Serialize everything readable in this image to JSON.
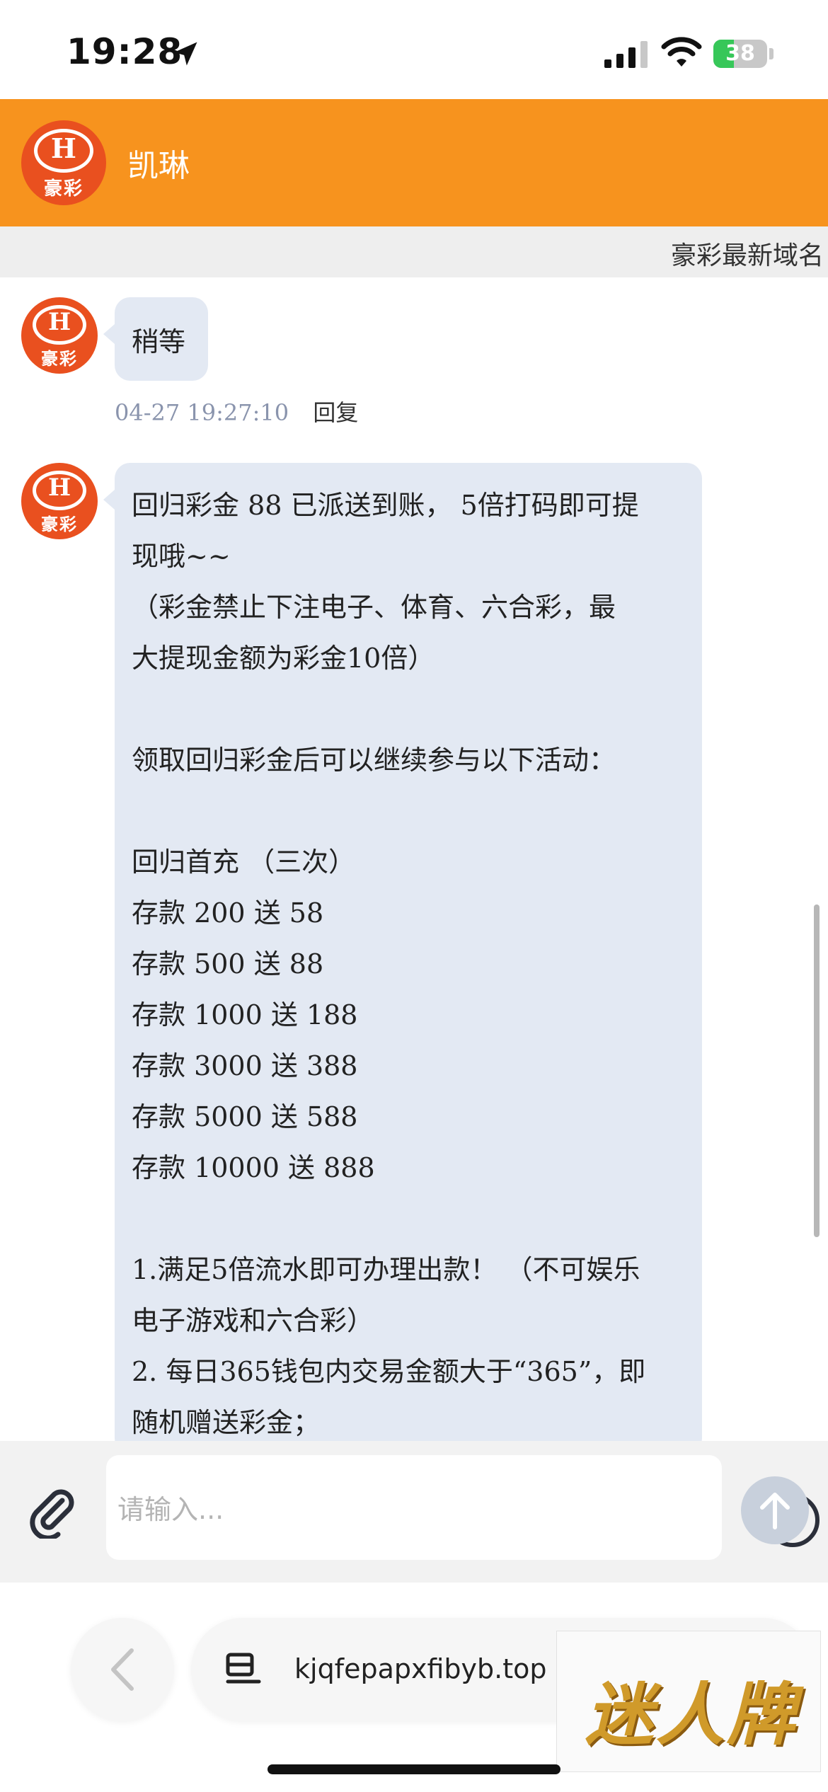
{
  "status_bar": {
    "time": "19:28",
    "battery_text": "38",
    "battery_level": 0.38
  },
  "header": {
    "logo_mark": "H",
    "logo_name": "豪彩",
    "title": "凯琳"
  },
  "marquee": {
    "text": "豪彩最新域名"
  },
  "messages": [
    {
      "text": "稍等",
      "timestamp": "04-27 19:27:10",
      "reply_label": "回复"
    },
    {
      "lines": [
        "回归彩金 88 已派送到账， 5倍打码即可提",
        "现哦~~",
        "（彩金禁止下注电子、体育、六合彩，最",
        "大提现金额为彩金10倍）",
        "",
        "领取回归彩金后可以继续参与以下活动：",
        "",
        "回归首充 （三次）",
        "存款 200 送 58",
        "存款 500 送 88",
        "存款 1000 送 188",
        "存款 3000 送 388",
        "存款 5000 送 588",
        "存款 10000 送 888",
        "",
        "1.满足5倍流水即可办理出款！ （不可娱乐",
        "电子游戏和六合彩）",
        "2. 每日365钱包内交易金额大于“365”，即",
        "随机赠送彩金；"
      ]
    }
  ],
  "input": {
    "placeholder": "请输入..."
  },
  "browser": {
    "url": "kjqfepapxfibyb.top"
  },
  "watermark": {
    "text": "迷人牌"
  },
  "colors": {
    "header": "#f7931e",
    "logo": "#e9501f",
    "bubble": "#e3e9f3",
    "send_button": "#c8d0dc"
  },
  "icons": [
    "location-arrow-icon",
    "signal-icon",
    "wifi-icon",
    "battery-icon",
    "paperclip-icon",
    "emoji-icon",
    "arrow-up-icon",
    "chevron-left-icon",
    "reader-icon"
  ]
}
